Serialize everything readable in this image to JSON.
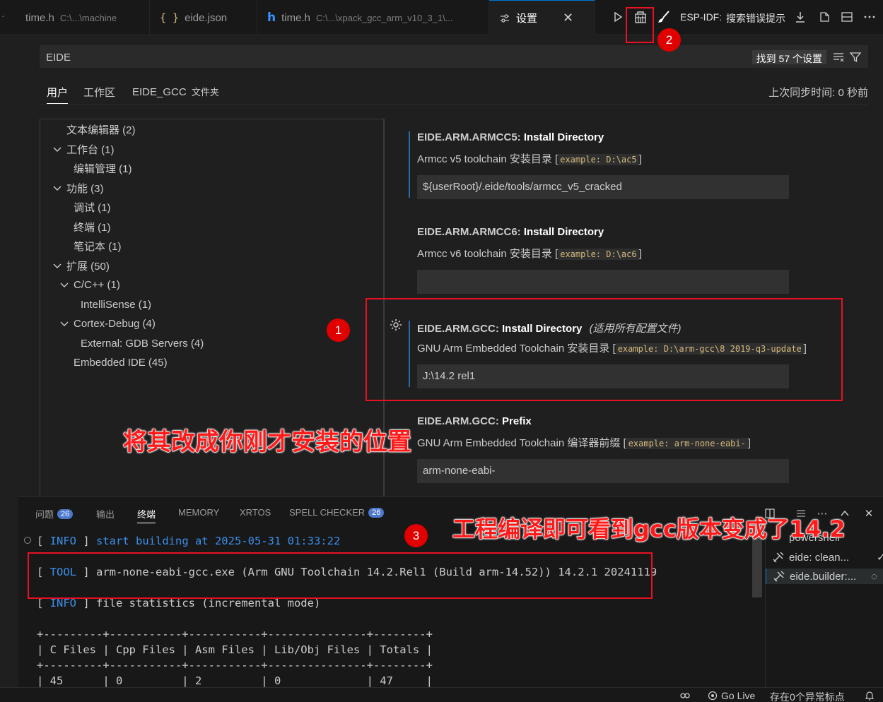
{
  "tabs": [
    {
      "label": "time.h",
      "path": "C:\\...\\machine",
      "icon": "c-header-icon"
    },
    {
      "label": "eide.json",
      "icon": "json-icon"
    },
    {
      "label": "time.h",
      "path": "C:\\...\\xpack_gcc_arm_v10_3_1\\...",
      "icon": "c-header-icon"
    },
    {
      "label": "设置",
      "icon": "settings-icon",
      "active": true
    }
  ],
  "toolbar": {
    "esp_idf_label": "ESP-IDF:",
    "search_error_label": "搜索错误提示"
  },
  "search": {
    "value": "EIDE",
    "result_count": "找到 57 个设置"
  },
  "scope_tabs": [
    "用户",
    "工作区",
    "EIDE_GCC"
  ],
  "scope_folder_suffix": "文件夹",
  "sync_time": "上次同步时间: 0 秒前",
  "toc": [
    {
      "label": "文本编辑器 (2)",
      "level": 0,
      "chevron": false
    },
    {
      "label": "工作台 (1)",
      "level": 0,
      "chevron": true
    },
    {
      "label": "编辑管理 (1)",
      "level": 1,
      "chevron": false
    },
    {
      "label": "功能 (3)",
      "level": 0,
      "chevron": true
    },
    {
      "label": "调试 (1)",
      "level": 1,
      "chevron": false
    },
    {
      "label": "终端 (1)",
      "level": 1,
      "chevron": false
    },
    {
      "label": "笔记本 (1)",
      "level": 1,
      "chevron": false
    },
    {
      "label": "扩展 (50)",
      "level": 0,
      "chevron": true
    },
    {
      "label": "C/C++ (1)",
      "level": 1,
      "chevron": true
    },
    {
      "label": "IntelliSense (1)",
      "level": 2,
      "chevron": false
    },
    {
      "label": "Cortex-Debug (4)",
      "level": 1,
      "chevron": true
    },
    {
      "label": "External: GDB Servers (4)",
      "level": 2,
      "chevron": false
    },
    {
      "label": "Embedded IDE (45)",
      "level": 1,
      "chevron": false
    }
  ],
  "settings": [
    {
      "category": "EIDE.ARM.ARMCC5:",
      "name": "Install Directory",
      "note": "",
      "desc": "Armcc v5 toolchain 安装目录",
      "example": "example: D:\\ac5",
      "value": "${userRoot}/.eide/tools/armcc_v5_cracked"
    },
    {
      "category": "EIDE.ARM.ARMCC6:",
      "name": "Install Directory",
      "note": "",
      "desc": "Armcc v6 toolchain 安装目录",
      "example": "example: D:\\ac6",
      "value": ""
    },
    {
      "category": "EIDE.ARM.GCC:",
      "name": "Install Directory",
      "note": "(适用所有配置文件)",
      "desc": "GNU Arm Embedded Toolchain 安装目录",
      "example": "example: D:\\arm-gcc\\8 2019-q3-update",
      "value": "J:\\14.2 rel1"
    },
    {
      "category": "EIDE.ARM.GCC:",
      "name": "Prefix",
      "note": "",
      "desc": "GNU Arm Embedded Toolchain 编译器前缀",
      "example": "example: arm-none-eabi-",
      "value": "arm-none-eabi-"
    }
  ],
  "annotations": {
    "badge1": "1",
    "badge2": "2",
    "badge3": "3",
    "callout_settings": "将其改成你刚才安装的位置",
    "callout_terminal": "工程编译即可看到gcc版本变成了14.2"
  },
  "panel": {
    "tabs": [
      {
        "label": "问题",
        "badge": "26"
      },
      {
        "label": "输出",
        "badge": ""
      },
      {
        "label": "终端",
        "badge": "",
        "active": true
      },
      {
        "label": "MEMORY",
        "badge": ""
      },
      {
        "label": "XRTOS",
        "badge": ""
      },
      {
        "label": "SPELL CHECKER",
        "badge": "26"
      }
    ],
    "terminal_lines": [
      {
        "bracket_open": "[ ",
        "level": "INFO",
        "bracket_close": " ] ",
        "text": "start building at 2025-05-31 01:33:22",
        "highlight": true
      },
      {
        "bracket_open": "[ ",
        "level": "TOOL",
        "bracket_close": " ] ",
        "text": "arm-none-eabi-gcc.exe (Arm GNU Toolchain 14.2.Rel1 (Build arm-14.52)) 14.2.1 20241119",
        "highlight": false
      },
      {
        "bracket_open": "[ ",
        "level": "INFO",
        "bracket_close": " ] ",
        "text": "file statistics (incremental mode)",
        "highlight": false
      }
    ],
    "table_border": "+---------+-----------+-----------+---------------+--------+",
    "table_header": "| C Files | Cpp Files | Asm Files | Lib/Obj Files | Totals |",
    "table_row": "| 45      | 0         | 2         | 0             | 47     |",
    "terminal_list": [
      {
        "label": "powershell",
        "status": ""
      },
      {
        "label": "eide: clean...",
        "status": "✓"
      },
      {
        "label": "eide.builder:...",
        "status": "◌"
      }
    ]
  },
  "status_bar": {
    "go_live": "Go Live",
    "exceptions": "存在0个异常标点"
  }
}
